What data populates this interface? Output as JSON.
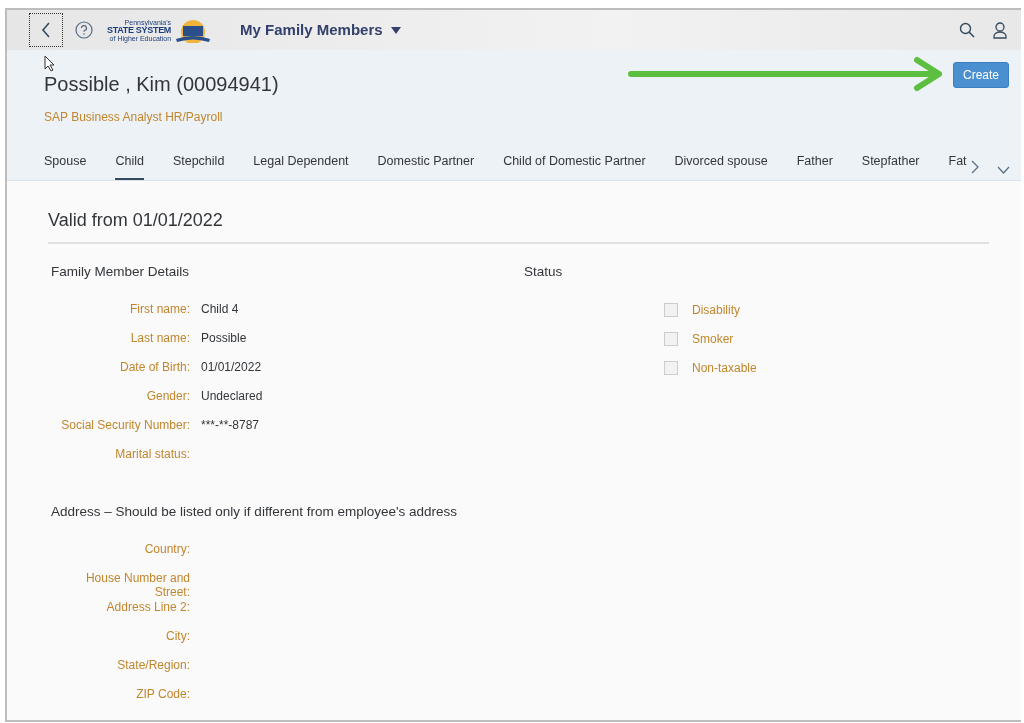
{
  "shell": {
    "logo": {
      "top": "Pennsylvania's",
      "main": "STATE SYSTEM",
      "sub": "of Higher Education"
    },
    "app_title": "My Family Members"
  },
  "header": {
    "title": "Possible , Kim (00094941)",
    "subtitle": "SAP Business Analyst HR/Payroll",
    "create_button": "Create"
  },
  "tabs": [
    {
      "label": "Spouse",
      "selected": false
    },
    {
      "label": "Child",
      "selected": true
    },
    {
      "label": "Stepchild",
      "selected": false
    },
    {
      "label": "Legal Dependent",
      "selected": false
    },
    {
      "label": "Domestic Partner",
      "selected": false
    },
    {
      "label": "Child of Domestic Partner",
      "selected": false
    },
    {
      "label": "Divorced spouse",
      "selected": false
    },
    {
      "label": "Father",
      "selected": false
    },
    {
      "label": "Stepfather",
      "selected": false
    },
    {
      "label": "Fat",
      "selected": false
    }
  ],
  "section_title": "Valid from 01/01/2022",
  "details": {
    "title": "Family Member Details",
    "fields": [
      {
        "label": "First name:",
        "value": "Child 4"
      },
      {
        "label": "Last name:",
        "value": "Possible"
      },
      {
        "label": "Date of Birth:",
        "value": "01/01/2022"
      },
      {
        "label": "Gender:",
        "value": "Undeclared"
      },
      {
        "label": "Social Security Number:",
        "value": "***-**-8787"
      },
      {
        "label": "Marital status:"
      }
    ]
  },
  "status": {
    "title": "Status",
    "options": [
      {
        "label": "Disability",
        "checked": false
      },
      {
        "label": "Smoker",
        "checked": false
      },
      {
        "label": "Non-taxable",
        "checked": false
      }
    ]
  },
  "address": {
    "title": "Address – Should be listed only if different from employee's address",
    "fields": [
      {
        "label": "Country:"
      },
      {
        "label": "House Number and Street:"
      },
      {
        "label": "Address Line 2:"
      },
      {
        "label": "City:"
      },
      {
        "label": "State/Region:"
      },
      {
        "label": "ZIP Code:"
      }
    ]
  }
}
